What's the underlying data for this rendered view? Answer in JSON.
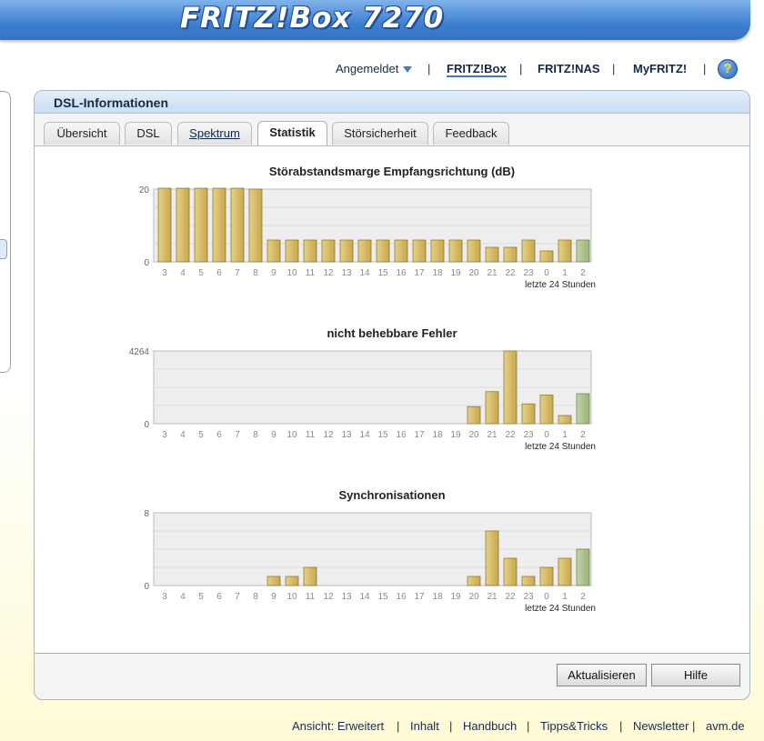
{
  "header": {
    "logo": "FRITZ!Box 7270"
  },
  "topnav": {
    "login_status": "Angemeldet",
    "items": [
      "FRITZ!Box",
      "FRITZ!NAS",
      "MyFRITZ!"
    ],
    "help_symbol": "?"
  },
  "panel": {
    "title": "DSL-Informationen",
    "tabs": [
      "Übersicht",
      "DSL",
      "Spektrum",
      "Statistik",
      "Störsicherheit",
      "Feedback"
    ],
    "active_tab": "Statistik"
  },
  "chart_data": [
    {
      "type": "bar",
      "title": "Störabstandsmarge Empfangsrichtung (dB)",
      "xlabel": "letzte 24 Stunden",
      "ylabel": "",
      "ytick_labels": [
        "0",
        "20"
      ],
      "ylim": [
        0,
        20
      ],
      "categories": [
        "3",
        "4",
        "5",
        "6",
        "7",
        "8",
        "9",
        "10",
        "11",
        "12",
        "13",
        "14",
        "15",
        "16",
        "17",
        "18",
        "19",
        "20",
        "21",
        "22",
        "23",
        "0",
        "1",
        "2"
      ],
      "values": [
        21,
        21,
        21,
        21,
        21,
        20,
        6,
        6,
        6,
        6,
        6,
        6,
        6,
        6,
        6,
        6,
        6,
        6,
        4,
        4,
        6,
        3,
        6,
        6
      ],
      "highlight_last": true,
      "colors": {
        "bar": "#c7a84a",
        "bar_light": "#e6d089",
        "last": "#9cb27a",
        "grid": "#dcdcdc",
        "plot_bg": "#eeeeee"
      }
    },
    {
      "type": "bar",
      "title": "nicht behebbare Fehler",
      "xlabel": "letzte 24 Stunden",
      "ylabel": "",
      "ytick_labels": [
        "0",
        "4264"
      ],
      "ylim": [
        0,
        4264
      ],
      "categories": [
        "3",
        "4",
        "5",
        "6",
        "7",
        "8",
        "9",
        "10",
        "11",
        "12",
        "13",
        "14",
        "15",
        "16",
        "17",
        "18",
        "19",
        "20",
        "21",
        "22",
        "23",
        "0",
        "1",
        "2"
      ],
      "values": [
        0,
        0,
        0,
        0,
        0,
        0,
        0,
        0,
        0,
        0,
        0,
        0,
        0,
        0,
        0,
        0,
        0,
        1000,
        1880,
        4264,
        1160,
        1680,
        480,
        1760
      ],
      "highlight_last": true,
      "colors": {
        "bar": "#c7a84a",
        "bar_light": "#e6d089",
        "last": "#9cb27a",
        "grid": "#dcdcdc",
        "plot_bg": "#eeeeee"
      }
    },
    {
      "type": "bar",
      "title": "Synchronisationen",
      "xlabel": "letzte 24 Stunden",
      "ylabel": "",
      "ytick_labels": [
        "0",
        "8"
      ],
      "ylim": [
        0,
        8
      ],
      "categories": [
        "3",
        "4",
        "5",
        "6",
        "7",
        "8",
        "9",
        "10",
        "11",
        "12",
        "13",
        "14",
        "15",
        "16",
        "17",
        "18",
        "19",
        "20",
        "21",
        "22",
        "23",
        "0",
        "1",
        "2"
      ],
      "values": [
        0,
        0,
        0,
        0,
        0,
        0,
        1,
        1,
        2,
        0,
        0,
        0,
        0,
        0,
        0,
        0,
        0,
        1,
        6,
        3,
        1,
        2,
        3,
        4
      ],
      "highlight_last": true,
      "colors": {
        "bar": "#c7a84a",
        "bar_light": "#e6d089",
        "last": "#9cb27a",
        "grid": "#dcdcdc",
        "plot_bg": "#eeeeee"
      }
    }
  ],
  "buttons": {
    "refresh": "Aktualisieren",
    "help": "Hilfe"
  },
  "footer": {
    "items": [
      "Ansicht: Erweitert",
      "Inhalt",
      "Handbuch",
      "Tipps&Tricks",
      "Newsletter",
      "avm.de"
    ]
  }
}
